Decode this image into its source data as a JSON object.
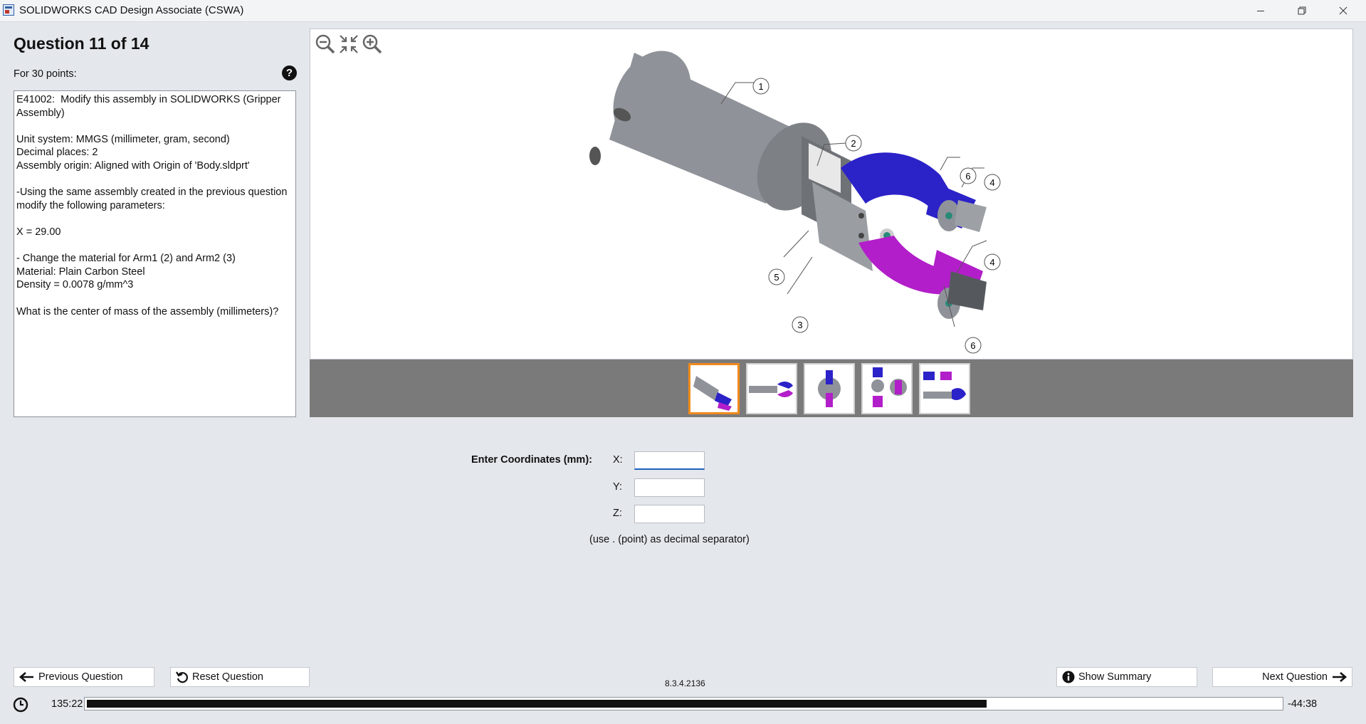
{
  "window": {
    "title": "SOLIDWORKS CAD Design Associate (CSWA)",
    "controls": [
      "minimize-icon",
      "restore-icon",
      "close-icon"
    ]
  },
  "question": {
    "heading": "Question 11 of 14",
    "points": "For 30 points:",
    "help_icon": "question-circle-icon",
    "help_glyph": "?",
    "text": "E41002:  Modify this assembly in SOLIDWORKS (Gripper Assembly)\n\nUnit system: MMGS (millimeter, gram, second)\nDecimal places: 2\nAssembly origin: Aligned with Origin of 'Body.sldprt'\n\n-Using the same assembly created in the previous question modify the following parameters:\n\nX = 29.00\n\n- Change the material for Arm1 (2) and Arm2 (3)\nMaterial: Plain Carbon Steel\nDensity = 0.0078 g/mm^3\n\nWhat is the center of mass of the assembly (millimeters)?"
  },
  "viewer": {
    "tools": [
      "zoom-out-icon",
      "fit-to-view-icon",
      "zoom-in-icon"
    ],
    "balloons": [
      "1",
      "2",
      "6",
      "4",
      "4",
      "5",
      "3",
      "6"
    ],
    "thumbnail_count": 5,
    "selected_thumbnail": 1,
    "colors": {
      "body": "#8f9399",
      "arm_blue": "#2b22c8",
      "arm_magenta": "#b21ec9",
      "pin": "#2a8a7a"
    }
  },
  "answer": {
    "label": "Enter Coordinates (mm):",
    "x_label": "X:",
    "y_label": "Y:",
    "z_label": "Z:",
    "x_value": "",
    "y_value": "",
    "z_value": "",
    "hint": "(use . (point) as decimal separator)"
  },
  "nav": {
    "previous": "Previous Question",
    "reset": "Reset Question",
    "summary": "Show Summary",
    "next": "Next Question",
    "version": "8.3.4.2136"
  },
  "timer": {
    "elapsed": "135:22",
    "remaining": "-44:38",
    "progress_fraction": 0.754
  },
  "accent_colors": {
    "selected_thumb": "#f08a1c",
    "input_focus": "#1f5fbf"
  }
}
